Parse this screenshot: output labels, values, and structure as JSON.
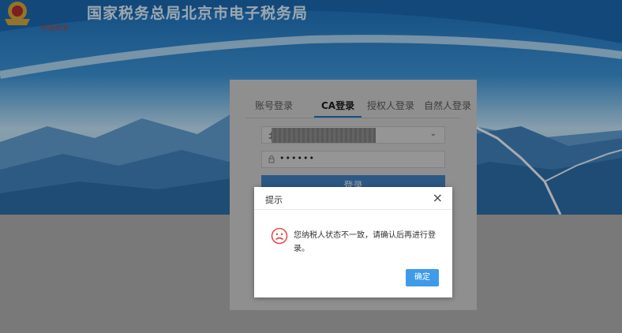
{
  "header": {
    "site_title": "国家税务总局北京市电子税务局",
    "logo_caption": "中国税务"
  },
  "login": {
    "tabs": [
      {
        "label": "账号登录",
        "active": false
      },
      {
        "label": "CA登录",
        "active": true
      },
      {
        "label": "授权人登录",
        "active": false
      },
      {
        "label": "自然人登录",
        "active": false
      }
    ],
    "certificate_select_value": "北",
    "password_value": "••••••",
    "login_button": "登录"
  },
  "dialog": {
    "title": "提示",
    "close_symbol": "×",
    "message": "您纳税人状态不一致，请确认后再进行登录。",
    "confirm_button": "确定"
  },
  "colors": {
    "accent": "#3d9be9",
    "icon_red": "#e84c4c",
    "tab_underline": "#1e6fb8"
  }
}
